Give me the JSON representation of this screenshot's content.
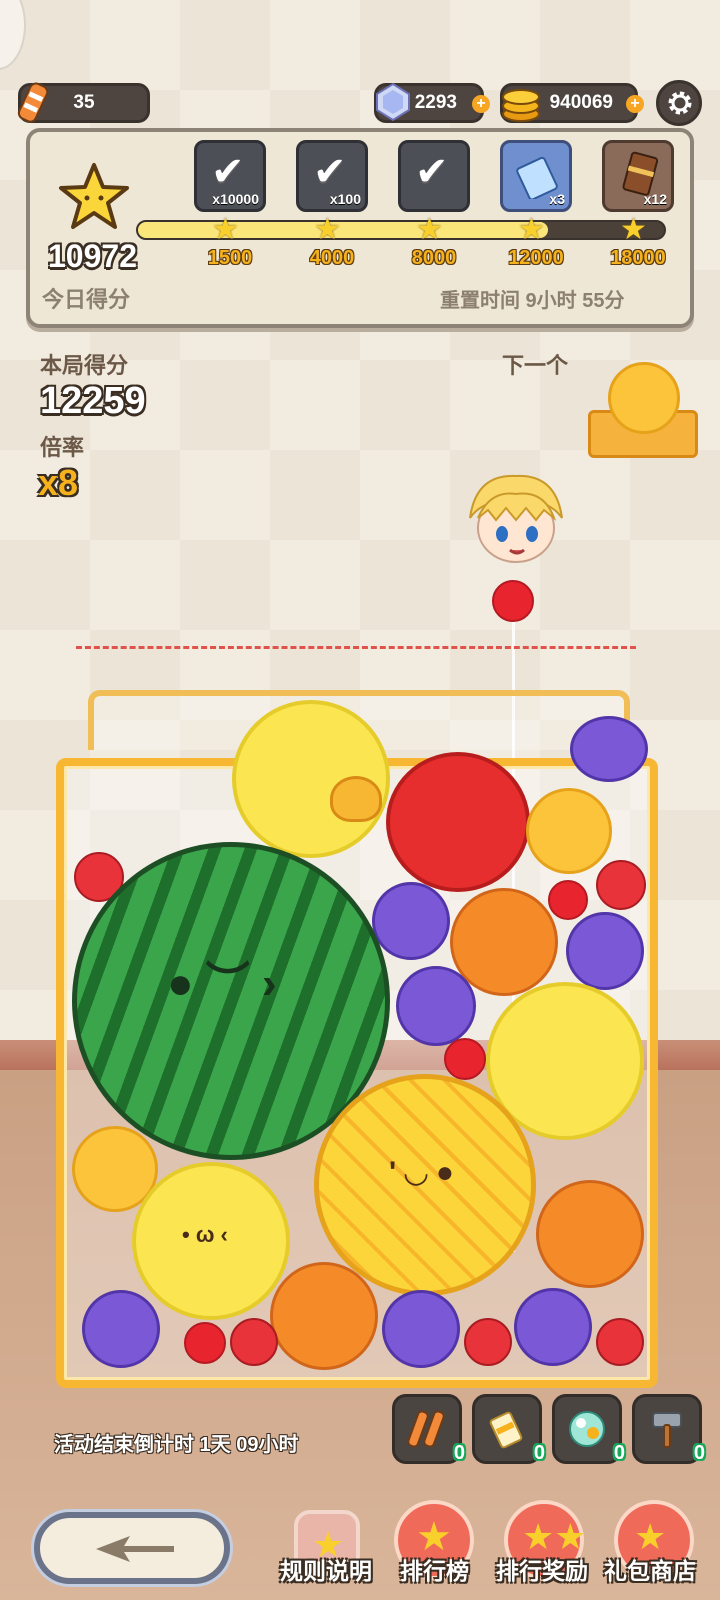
{
  "currencies": {
    "energy": "35",
    "gems": "2293",
    "coins": "940069"
  },
  "daily": {
    "score": "10972",
    "score_label": "今日得分",
    "reset_label": "重置时间 9小时 55分",
    "progress_fraction": 0.78,
    "rewards": [
      {
        "qty": "x10000",
        "claimed": true
      },
      {
        "qty": "x100",
        "claimed": true
      },
      {
        "qty": "",
        "claimed": true
      },
      {
        "qty": "x3",
        "claimed": false
      },
      {
        "qty": "x12",
        "claimed": false
      }
    ],
    "milestones": [
      "1500",
      "4000",
      "8000",
      "12000",
      "18000"
    ]
  },
  "round": {
    "score_label": "本局得分",
    "score": "12259",
    "multiplier_label": "倍率",
    "multiplier": "x8",
    "next_label": "下一个"
  },
  "event": {
    "countdown": "活动结束倒计时 1天 09小时"
  },
  "tools": [
    {
      "icon": "candy-sticks-icon",
      "count": "0"
    },
    {
      "icon": "glue-tube-icon",
      "count": "0"
    },
    {
      "icon": "crystal-ball-icon",
      "count": "0"
    },
    {
      "icon": "hammer-icon",
      "count": "0"
    }
  ],
  "nav": {
    "rules": "规则说明",
    "leaderboard": "排行榜",
    "rank_rewards": "排行奖励",
    "gift_shop": "礼包商店"
  }
}
